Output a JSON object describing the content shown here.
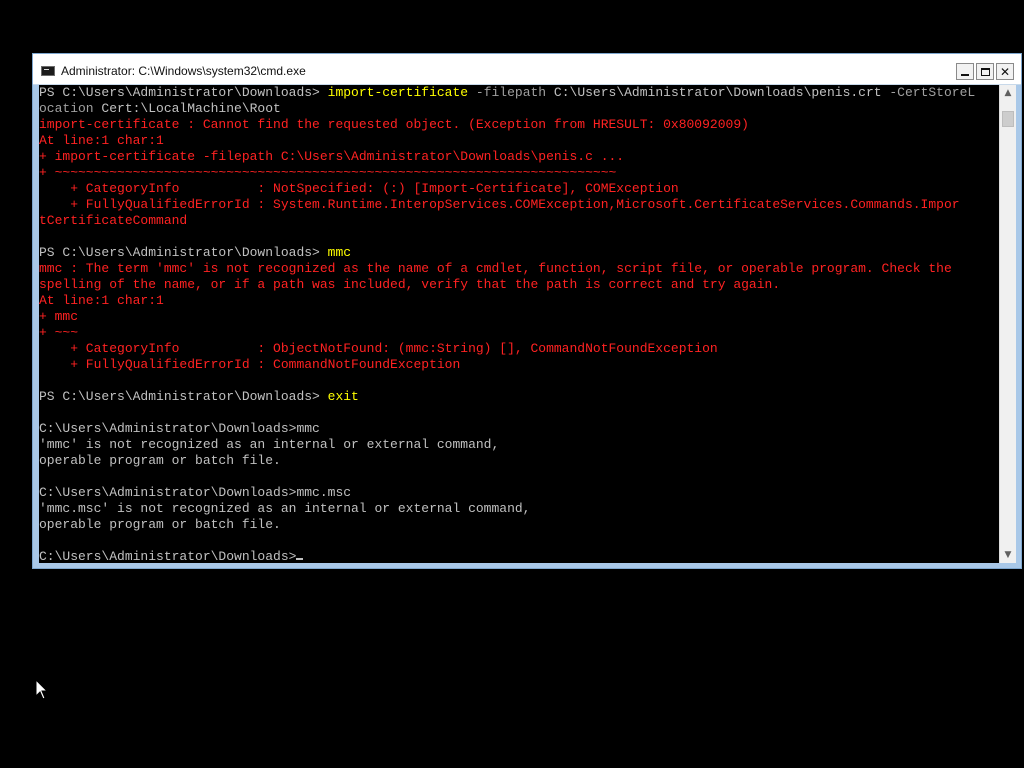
{
  "window": {
    "title": "Administrator: C:\\Windows\\system32\\cmd.exe",
    "controls": {
      "minimize": "minimize",
      "maximize": "maximize",
      "close": "✕"
    }
  },
  "console": {
    "lines": [
      [
        {
          "t": "PS C:\\Users\\Administrator\\Downloads> ",
          "c": "w"
        },
        {
          "t": "import-certificate",
          "c": "y"
        },
        {
          "t": " -filepath ",
          "c": "g"
        },
        {
          "t": "C:\\Users\\Administrator\\Downloads\\penis.crt",
          "c": "w"
        },
        {
          "t": " -CertStoreL",
          "c": "g"
        }
      ],
      [
        {
          "t": "ocation",
          "c": "g"
        },
        {
          "t": " Cert:\\LocalMachine\\Root",
          "c": "w"
        }
      ],
      [
        {
          "t": "import-certificate : Cannot find the requested object. (Exception from HRESULT: 0x80092009)",
          "c": "r"
        }
      ],
      [
        {
          "t": "At line:1 char:1",
          "c": "r"
        }
      ],
      [
        {
          "t": "+ import-certificate -filepath C:\\Users\\Administrator\\Downloads\\penis.c ...",
          "c": "r"
        }
      ],
      [
        {
          "t": "+ ~~~~~~~~~~~~~~~~~~~~~~~~~~~~~~~~~~~~~~~~~~~~~~~~~~~~~~~~~~~~~~~~~~~~~~~~",
          "c": "r"
        }
      ],
      [
        {
          "t": "    + CategoryInfo          : NotSpecified: (:) [Import-Certificate], COMException",
          "c": "r"
        }
      ],
      [
        {
          "t": "    + FullyQualifiedErrorId : System.Runtime.InteropServices.COMException,Microsoft.CertificateServices.Commands.Impor",
          "c": "r"
        }
      ],
      [
        {
          "t": "tCertificateCommand",
          "c": "r"
        }
      ],
      [
        {
          "t": "",
          "c": "w"
        }
      ],
      [
        {
          "t": "PS C:\\Users\\Administrator\\Downloads> ",
          "c": "w"
        },
        {
          "t": "mmc",
          "c": "y"
        }
      ],
      [
        {
          "t": "mmc : The term 'mmc' is not recognized as the name of a cmdlet, function, script file, or operable program. Check the",
          "c": "r"
        }
      ],
      [
        {
          "t": "spelling of the name, or if a path was included, verify that the path is correct and try again.",
          "c": "r"
        }
      ],
      [
        {
          "t": "At line:1 char:1",
          "c": "r"
        }
      ],
      [
        {
          "t": "+ mmc",
          "c": "r"
        }
      ],
      [
        {
          "t": "+ ~~~",
          "c": "r"
        }
      ],
      [
        {
          "t": "    + CategoryInfo          : ObjectNotFound: (mmc:String) [], CommandNotFoundException",
          "c": "r"
        }
      ],
      [
        {
          "t": "    + FullyQualifiedErrorId : CommandNotFoundException",
          "c": "r"
        }
      ],
      [
        {
          "t": "",
          "c": "w"
        }
      ],
      [
        {
          "t": "PS C:\\Users\\Administrator\\Downloads> ",
          "c": "w"
        },
        {
          "t": "exit",
          "c": "y"
        }
      ],
      [
        {
          "t": "",
          "c": "w"
        }
      ],
      [
        {
          "t": "C:\\Users\\Administrator\\Downloads>mmc",
          "c": "w"
        }
      ],
      [
        {
          "t": "'mmc' is not recognized as an internal or external command,",
          "c": "w"
        }
      ],
      [
        {
          "t": "operable program or batch file.",
          "c": "w"
        }
      ],
      [
        {
          "t": "",
          "c": "w"
        }
      ],
      [
        {
          "t": "C:\\Users\\Administrator\\Downloads>mmc.msc",
          "c": "w"
        }
      ],
      [
        {
          "t": "'mmc.msc' is not recognized as an internal or external command,",
          "c": "w"
        }
      ],
      [
        {
          "t": "operable program or batch file.",
          "c": "w"
        }
      ],
      [
        {
          "t": "",
          "c": "w"
        }
      ],
      [
        {
          "t": "C:\\Users\\Administrator\\Downloads>",
          "c": "w"
        }
      ]
    ]
  },
  "scrollbar": {
    "up_icon": "▲",
    "down_icon": "▼"
  },
  "colors": {
    "background": "#000000",
    "text": "#c0c0c0",
    "error": "#ff2222",
    "command": "#ffff00",
    "parameter": "#a0a0a0"
  },
  "icons": {
    "window_icon": "cmd-icon",
    "mouse": "arrow-cursor-icon"
  }
}
